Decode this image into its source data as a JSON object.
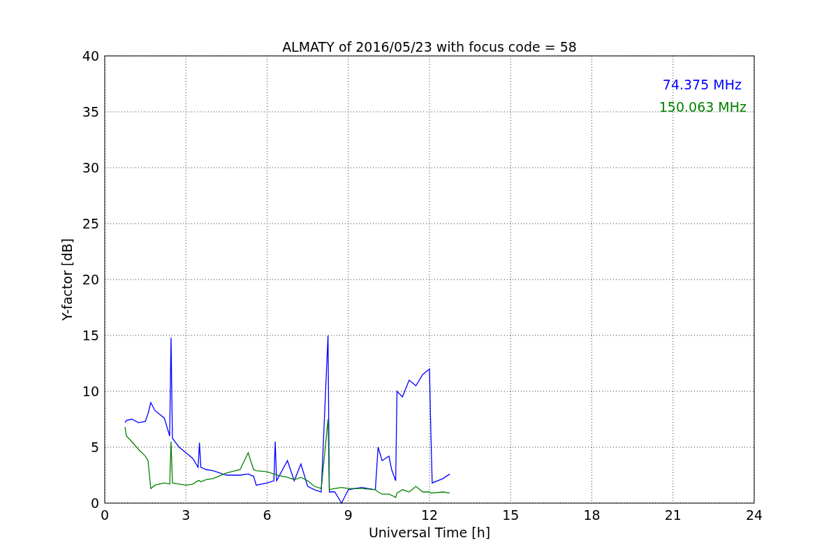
{
  "chart_data": {
    "type": "line",
    "title": "ALMATY of 2016/05/23 with focus code = 58",
    "xlabel": "Universal Time [h]",
    "ylabel": "Y-factor [dB]",
    "x": [
      0.75,
      0.8,
      1.0,
      1.25,
      1.5,
      1.6,
      1.7,
      1.85,
      2.0,
      2.2,
      2.4,
      2.45,
      2.5,
      2.75,
      3.0,
      3.25,
      3.45,
      3.5,
      3.55,
      3.75,
      4.0,
      4.5,
      5.0,
      5.3,
      5.5,
      5.6,
      6.0,
      6.25,
      6.3,
      6.35,
      6.75,
      7.0,
      7.25,
      7.5,
      7.75,
      8.0,
      8.25,
      8.3,
      8.5,
      8.75,
      9.0,
      9.5,
      10.0,
      10.1,
      10.25,
      10.5,
      10.6,
      10.75,
      10.8,
      11.0,
      11.25,
      11.5,
      11.75,
      12.0,
      12.05,
      12.1,
      12.5,
      12.75
    ],
    "series": [
      {
        "name": "74.375 MHz",
        "color": "#0000ff",
        "values": [
          7.2,
          7.4,
          7.5,
          7.2,
          7.3,
          8.0,
          9.0,
          8.3,
          8.0,
          7.6,
          6.0,
          14.8,
          5.8,
          5.0,
          4.5,
          4.0,
          3.2,
          5.4,
          3.2,
          3.0,
          2.9,
          2.5,
          2.5,
          2.6,
          2.4,
          1.6,
          1.8,
          2.0,
          5.5,
          2.0,
          3.8,
          2.0,
          3.5,
          1.5,
          1.2,
          1.0,
          15.0,
          1.0,
          1.0,
          0.0,
          1.2,
          1.4,
          1.2,
          5.0,
          3.8,
          4.2,
          3.0,
          2.0,
          10.0,
          9.5,
          11.0,
          10.5,
          11.5,
          12.0,
          6.5,
          1.8,
          2.2,
          2.6
        ]
      },
      {
        "name": "150.063 MHz",
        "color": "#008000",
        "values": [
          6.8,
          6.0,
          5.5,
          4.8,
          4.2,
          3.8,
          1.3,
          1.6,
          1.7,
          1.8,
          1.7,
          5.5,
          1.8,
          1.7,
          1.6,
          1.7,
          2.0,
          2.0,
          1.9,
          2.1,
          2.2,
          2.7,
          3.0,
          4.5,
          3.0,
          2.9,
          2.8,
          2.6,
          2.6,
          2.5,
          2.3,
          2.1,
          2.3,
          2.0,
          1.5,
          1.3,
          7.5,
          1.2,
          1.3,
          1.4,
          1.3,
          1.3,
          1.2,
          1.0,
          0.8,
          0.8,
          0.7,
          0.5,
          0.9,
          1.2,
          1.0,
          1.5,
          1.0,
          1.0,
          0.9,
          0.9,
          1.0,
          0.9
        ]
      }
    ],
    "grid": true,
    "xlim": [
      0,
      24
    ],
    "ylim": [
      0,
      40
    ],
    "xticks": [
      0,
      3,
      6,
      9,
      12,
      15,
      18,
      21,
      24
    ],
    "yticks": [
      0,
      5,
      10,
      15,
      20,
      25,
      30,
      35,
      40
    ]
  }
}
